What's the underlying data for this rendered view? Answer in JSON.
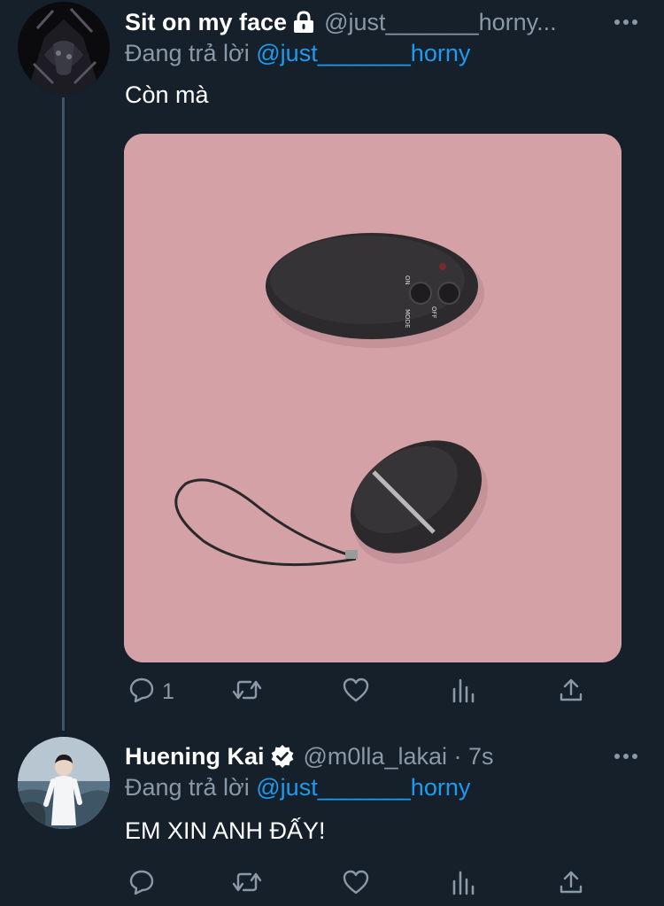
{
  "tweets": [
    {
      "display_name": "Sit on my face",
      "badge": "lock-icon",
      "handle": "@just_______horny...",
      "reply_prefix": "Đang trả lời ",
      "reply_mention": "@just_______horny",
      "text": "Còn mà",
      "media": "product-photo",
      "actions": {
        "reply_count": "1"
      }
    },
    {
      "display_name": "Huening Kai",
      "badge": "verified-icon",
      "handle": "@m0lla_lakai · 7s",
      "reply_prefix": "Đang trả lời ",
      "reply_mention": "@just_______horny",
      "text": "EM XIN ANH ĐẤY!",
      "actions": {
        "reply_count": ""
      }
    }
  ],
  "icons": [
    "more-icon",
    "reply-icon",
    "retweet-icon",
    "like-icon",
    "analytics-icon",
    "share-icon"
  ],
  "colors": {
    "background": "#15202b",
    "secondary_text": "#8b98a5",
    "link": "#1d9bf0",
    "thread_line": "#3d5466"
  }
}
